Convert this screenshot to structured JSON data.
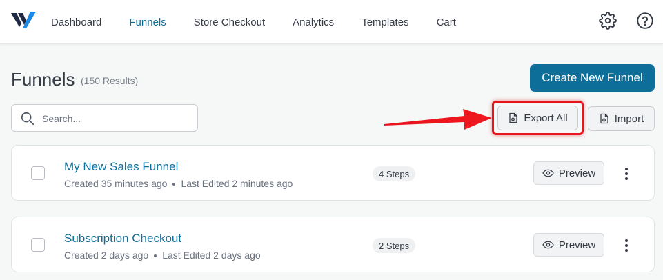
{
  "nav": {
    "items": [
      {
        "label": "Dashboard",
        "active": false
      },
      {
        "label": "Funnels",
        "active": true
      },
      {
        "label": "Store Checkout",
        "active": false
      },
      {
        "label": "Analytics",
        "active": false
      },
      {
        "label": "Templates",
        "active": false
      },
      {
        "label": "Cart",
        "active": false
      }
    ],
    "icons": [
      "gear-icon",
      "help-icon"
    ]
  },
  "header": {
    "title": "Funnels",
    "results": "(150 Results)",
    "create_label": "Create New Funnel"
  },
  "toolbar": {
    "search_placeholder": "Search...",
    "export_label": "Export All",
    "import_label": "Import"
  },
  "funnels": [
    {
      "title": "My New Sales Funnel",
      "created": "Created 35 minutes ago",
      "edited": "Last Edited 2 minutes ago",
      "steps": "4 Steps",
      "preview_label": "Preview"
    },
    {
      "title": "Subscription Checkout",
      "created": "Created 2 days ago",
      "edited": "Last Edited 2 days ago",
      "steps": "2 Steps",
      "preview_label": "Preview"
    }
  ],
  "colors": {
    "accent": "#0e6e9a",
    "annotation": "#e8141b",
    "background": "#f6f7f7"
  }
}
